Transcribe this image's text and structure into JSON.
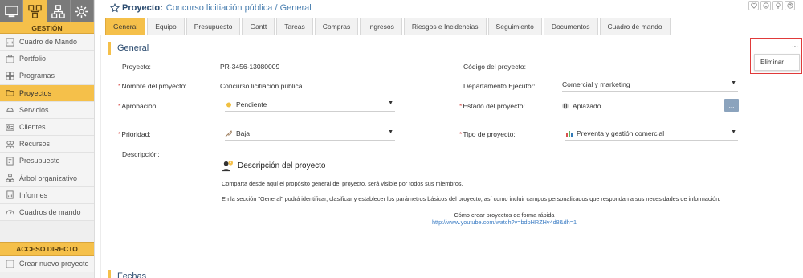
{
  "sidebar": {
    "modules": [
      {
        "name": "monitor-icon",
        "active": false
      },
      {
        "name": "hierarchy-icon",
        "active": true
      },
      {
        "name": "org-chart-icon",
        "active": false
      },
      {
        "name": "gear-icon",
        "active": false
      }
    ],
    "section_title": "GESTIÓN",
    "items": [
      {
        "label": "Cuadro de Mando",
        "icon": "dashboard-icon"
      },
      {
        "label": "Portfolio",
        "icon": "portfolio-icon"
      },
      {
        "label": "Programas",
        "icon": "programs-icon"
      },
      {
        "label": "Proyectos",
        "icon": "folder-icon",
        "active": true
      },
      {
        "label": "Servicios",
        "icon": "services-icon"
      },
      {
        "label": "Clientes",
        "icon": "clients-icon"
      },
      {
        "label": "Recursos",
        "icon": "resources-icon"
      },
      {
        "label": "Presupuesto",
        "icon": "budget-icon"
      },
      {
        "label": "Árbol organizativo",
        "icon": "tree-icon"
      },
      {
        "label": "Informes",
        "icon": "reports-icon"
      },
      {
        "label": "Cuadros de mando",
        "icon": "dashboards-icon"
      }
    ],
    "shortcut_title": "ACCESO DIRECTO",
    "shortcut_items": [
      {
        "label": "Crear nuevo proyecto",
        "icon": "new-project-icon"
      }
    ]
  },
  "header": {
    "prefix": "Proyecto:",
    "name": "Concurso licitiación pública / General",
    "top_icons": [
      "heart-icon",
      "smiley-icon",
      "lightbulb-icon",
      "help-icon"
    ]
  },
  "tabs": [
    "General",
    "Equipo",
    "Presupuesto",
    "Gantt",
    "Tareas",
    "Compras",
    "Ingresos",
    "Riesgos e Incidencias",
    "Seguimiento",
    "Documentos",
    "Cuadro de mando"
  ],
  "active_tab": "General",
  "section": {
    "title": "General",
    "next_title": "Fechas"
  },
  "form": {
    "proyecto_label": "Proyecto:",
    "proyecto_value": "PR-3456-13080009",
    "codigo_label": "Código del proyecto:",
    "codigo_value": "",
    "nombre_label": "Nombre del proyecto:",
    "nombre_value": "Concurso licitiación pública",
    "departamento_label": "Departamento Ejecutor:",
    "departamento_value": "Comercial y marketing",
    "aprobacion_label": "Aprobación:",
    "aprobacion_value": "Pendiente",
    "estado_label": "Estado del proyecto:",
    "estado_value": "Aplazado",
    "estado_button": "...",
    "prioridad_label": "Prioridad:",
    "prioridad_value": "Baja",
    "tipo_label": "Tipo de proyecto:",
    "tipo_value": "Preventa y gestión comercial",
    "descripcion_label": "Descripción:",
    "required_mark": "*",
    "caret": "▼"
  },
  "description": {
    "title": "Descripción del proyecto",
    "p1": "Comparta desde aquí el propósito general del proyecto, será visible por todos sus miembros.",
    "p2": "En la sección \"General\" podrá identificar, clasificar y establecer los parámetros básicos del proyecto, así como incluir campos personalizados que respondan a sus necesidades de información.",
    "video_caption": "Cómo crear proyectos de forma rápida",
    "video_link": "http://www.youtube.com/watch?v=bdpHRZHv4d8&dh=1"
  },
  "menu": {
    "more_label": "···",
    "items": [
      "Eliminar"
    ]
  },
  "colors": {
    "accent": "#f5c04a",
    "title_blue": "#2a4a6e",
    "link_blue": "#3a7cc4",
    "highlight_red": "#e03a3a"
  }
}
